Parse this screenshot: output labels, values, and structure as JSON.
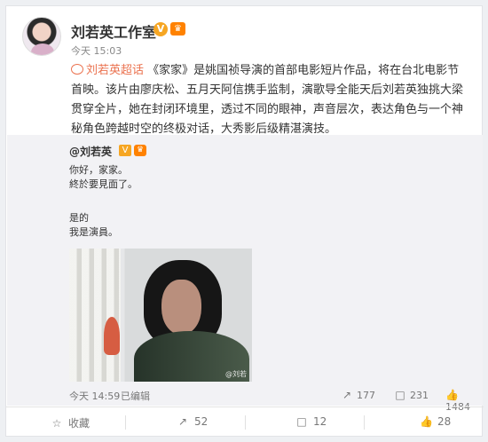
{
  "post": {
    "author": "刘若英工作室",
    "verified_badge": "V",
    "fan_badge": "♛",
    "time": "今天 15:03",
    "topic": "刘若英超话",
    "content_line_1_rest": " 《家家》是姚国祯导演的首部电影短片作品，将在台北电影节",
    "content_line_2": "首映。该片由廖庆松、五月天阿信携手监制，演歌导全能天后刘若英独挑大梁",
    "content_line_3": "贯穿全片，她在封闭环境里，透过不同的眼神，声音层次，表达角色与一个神",
    "content_line_4": "秘角色跨越时空的终极对话，大秀影后级精湛演技。"
  },
  "repost": {
    "author": "@刘若英",
    "badge_1": "V",
    "badge_2": "♛",
    "lines": [
      "你好，家家。",
      "終於要見面了。",
      "",
      "是的",
      "我是演員。"
    ],
    "watermark": "@刘若",
    "time": "今天 14:59",
    "edited": "已编辑",
    "share_count": "177",
    "comment_count": "231",
    "like_count": "1484"
  },
  "actions": {
    "save": "收藏",
    "share_count": "52",
    "comment_count": "12",
    "like_count": "28"
  },
  "colors": {
    "topic": "#eb7350",
    "verified": "#f6a623",
    "fan": "#ff8200"
  },
  "icons": {
    "save": "star-icon",
    "share": "share-icon",
    "comment": "comment-icon",
    "like": "thumb-up-icon"
  }
}
